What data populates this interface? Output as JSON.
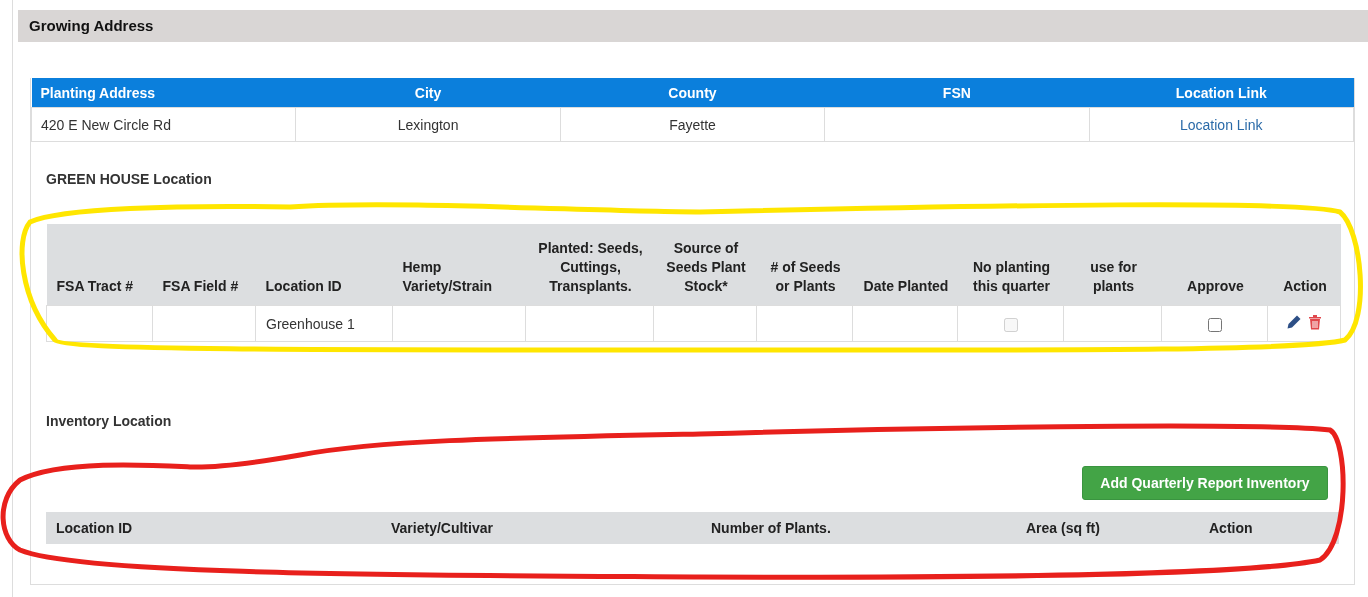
{
  "section": {
    "title": "Growing Address"
  },
  "address_table": {
    "columns": [
      "Planting Address",
      "City",
      "County",
      "FSN",
      "Location Link"
    ],
    "rows": [
      {
        "cells": [
          {
            "kind": "text",
            "text": "420 E New Circle Rd"
          },
          {
            "kind": "text",
            "text": "Lexington"
          },
          {
            "kind": "text",
            "text": "Fayette"
          },
          {
            "kind": "empty"
          },
          {
            "kind": "link",
            "text": "Location Link"
          }
        ]
      }
    ]
  },
  "greenhouse": {
    "title": "GREEN HOUSE Location",
    "columns": [
      "FSA Tract #",
      "FSA Field #",
      "Location ID",
      "Hemp Variety/Strain",
      "Planted: Seeds, Cuttings, Transplants.",
      "Source of Seeds Plant Stock*",
      "# of Seeds or Plants",
      "Date Planted",
      "No planting this quarter",
      "use for plants",
      "Approve",
      "Action"
    ],
    "rows": [
      {
        "cells": [
          {
            "kind": "empty"
          },
          {
            "kind": "empty"
          },
          {
            "kind": "text",
            "text": "Greenhouse 1"
          },
          {
            "kind": "empty"
          },
          {
            "kind": "empty"
          },
          {
            "kind": "empty"
          },
          {
            "kind": "empty"
          },
          {
            "kind": "empty"
          },
          {
            "kind": "checkbox",
            "checked": false,
            "disabled": true
          },
          {
            "kind": "empty"
          },
          {
            "kind": "checkbox",
            "checked": false,
            "disabled": false
          },
          {
            "kind": "actions"
          }
        ]
      }
    ]
  },
  "inventory": {
    "title": "Inventory Location",
    "button": "Add Quarterly Report Inventory",
    "columns": [
      "Location ID",
      "Variety/Cultivar",
      "Number of Plants.",
      "Area (sq ft)",
      "Action"
    ]
  },
  "annotations": [
    {
      "kind": "loop",
      "color": "#ffe600"
    },
    {
      "kind": "loop",
      "color": "#e8201c"
    }
  ]
}
